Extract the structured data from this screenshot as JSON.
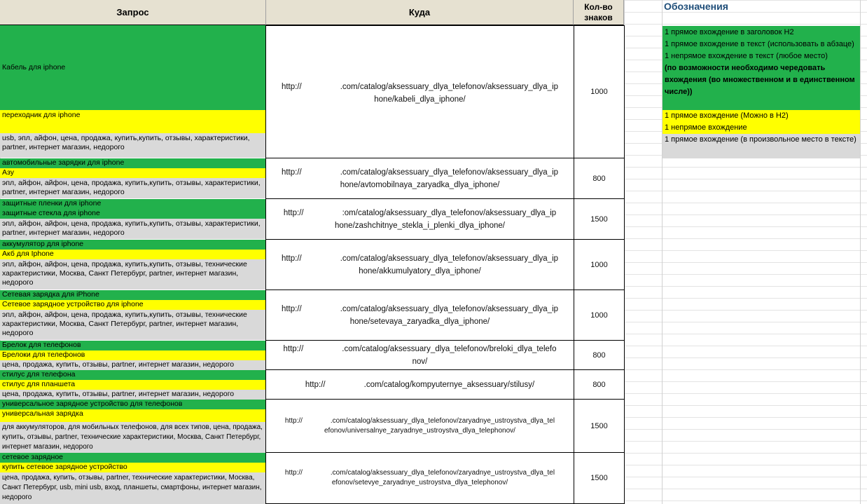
{
  "headers": {
    "query": "Запрос",
    "target": "Куда",
    "chars": "Кол-во знаков",
    "legend": "Обозначения"
  },
  "rows": [
    {
      "green": [
        "Кабель для iphone"
      ],
      "yellow": [
        "переходник для iphone"
      ],
      "gray": "usb, эпл, айфон, цена, продажа, купить,купить, отзывы, характеристики, partner, интернет магазин, недорого",
      "url": "http://[redacted].com/catalog/aksessuary_dlya_telefonov/aksessuary_dlya_iphone/kabeli_dlya_iphone/",
      "chars": "1000"
    },
    {
      "green": [
        "автомобильные зарядки для iphone"
      ],
      "yellow": [
        "Азу"
      ],
      "gray": "эпл, айфон, айфон, цена, продажа, купить,купить, отзывы, характеристики, partner, интернет магазин, недорого",
      "url": "http://[redacted].com/catalog/aksessuary_dlya_telefonov/aksessuary_dlya_iphone/avtomobilnaya_zaryadka_dlya_iphone/",
      "chars": "800"
    },
    {
      "green": [
        "защитные пленки для iphone",
        "защитные стекла для iphone"
      ],
      "yellow": [],
      "gray": "эпл, айфон, айфон, цена, продажа, купить,купить, отзывы, характеристики, partner, интернет магазин, недорого",
      "url": "http://[redacted].com/catalog/aksessuary_dlya_telefonov/aksessuary_dlya_iphone/zashchitnye_stekla_i_plenki_dlya_iphone/",
      "chars": "1500"
    },
    {
      "green": [
        "аккумулятор для iphone"
      ],
      "yellow": [
        "Акб для Iphone"
      ],
      "gray": "эпл, айфон, айфон, цена, продажа, купить,купить, отзывы, технические характеристики, Москва, Санкт Петербург, partner, интернет магазин, недорого",
      "url": "http://[redacted].com/catalog/aksessuary_dlya_telefonov/aksessuary_dlya_iphone/akkumulyatory_dlya_iphone/",
      "chars": "1000"
    },
    {
      "green": [
        "Сетевая зарядка для iPhone"
      ],
      "yellow": [
        "Сетевое зарядное устройство для iphone"
      ],
      "gray": "эпл, айфон, айфон, цена, продажа, купить,купить, отзывы, технические характеристики, Москва, Санкт Петербург, partner, интернет магазин, недорого",
      "url": "http://[redacted].com/catalog/aksessuary_dlya_telefonov/aksessuary_dlya_iphone/setevaya_zaryadka_dlya_iphone/",
      "chars": "1000"
    },
    {
      "green": [
        "Брелок для телефонов"
      ],
      "yellow": [
        "Брелоки для телефонов"
      ],
      "gray": "цена, продажа, купить, отзывы, partner, интернет магазин, недорого",
      "url": "http://[redacted].com/catalog/aksessuary_dlya_telefonov/breloki_dlya_telefonov/",
      "chars": "800"
    },
    {
      "green": [
        "стилус для телефона"
      ],
      "yellow": [
        "стилус для планшета"
      ],
      "gray": "цена, продажа, купить, отзывы, partner, интернет магазин, недорого",
      "url": "http://[redacted].com/catalog/kompyuternye_aksessuary/stilusy/",
      "chars": "800"
    },
    {
      "green": [
        "универсальное зарядное устройство для телефонов"
      ],
      "yellow": [
        "универсальная зарядка"
      ],
      "gray": "для аккумуляторов, для мобильных телефонов, для всех типов, цена, продажа, купить, отзывы, partner, технические характеристики, Москва, Санкт Петербург, интернет магазин, недорого",
      "url": "http://[redacted].com/catalog/aksessuary_dlya_telefonov/zaryadnye_ustroystva_dlya_telefonov/universalnye_zaryadnye_ustroystva_dlya_telephonov/",
      "chars": "1500"
    },
    {
      "green": [
        "сетевое зарядное"
      ],
      "yellow": [
        "купить сетевое зарядное устройство"
      ],
      "gray": "цена, продажа, купить, отзывы, partner, технические характеристики, Москва, Санкт Петербург, usb, mini usb, вход, планшеты, смартфоны, интернет магазин, недорого",
      "url": "http://[redacted].com/catalog/aksessuary_dlya_telefonov/zaryadnye_ustroystva_dlya_telefonov/setevye_zaryadnye_ustroystva_dlya_telephonov/",
      "chars": "1500"
    }
  ],
  "url_display": [
    [
      "http://",
      ".com/catalog/aksessuary_dlya_telefonov/aksessuary_dlya_ip",
      "hone/kabeli_dlya_iphone/"
    ],
    [
      "http://",
      ".com/catalog/aksessuary_dlya_telefonov/aksessuary_dlya_ip",
      "hone/avtomobilnaya_zaryadka_dlya_iphone/"
    ],
    [
      "http://",
      ":om/catalog/aksessuary_dlya_telefonov/aksessuary_dlya_ip",
      "hone/zashchitnye_stekla_i_plenki_dlya_iphone/"
    ],
    [
      "http://",
      ".com/catalog/aksessuary_dlya_telefonov/aksessuary_dlya_ip",
      "hone/akkumulyatory_dlya_iphone/"
    ],
    [
      "http://",
      ".com/catalog/aksessuary_dlya_telefonov/aksessuary_dlya_ip",
      "hone/setevaya_zaryadka_dlya_iphone/"
    ],
    [
      "http://",
      ".com/catalog/aksessuary_dlya_telefonov/breloki_dlya_telefo",
      "nov/"
    ],
    [
      "http://",
      ".com/catalog/kompyuternye_aksessuary/stilusy/",
      ""
    ],
    [
      "http://",
      ".com/catalog/aksessuary_dlya_telefonov/zaryadnye_ustroystva_dlya_tel",
      "efonov/universalnye_zaryadnye_ustroystva_dlya_telephonov/"
    ],
    [
      "http://",
      ".com/catalog/aksessuary_dlya_telefonov/zaryadnye_ustroystva_dlya_tel",
      "efonov/setevye_zaryadnye_ustroystva_dlya_telephonov/"
    ]
  ],
  "legend": {
    "green": [
      "1 прямое вхождение в заголовок H2",
      "1 прямое вхождение в текст (использовать в абзаце)",
      "1 непрямое вхождение в текст (любое место)"
    ],
    "green_bold": "(по возможности необходимо чередовать вхождения (во множественном и в единственном числе))",
    "yellow": [
      "1 прямое вхождение (Можно в H2)",
      "1 непрямое вхождение"
    ],
    "gray": "1 прямое вхождение (в произвольное место в тексте)"
  },
  "colors": {
    "green": "#22b14c",
    "yellow": "#ffff00",
    "gray": "#d9d9d9",
    "header": "#e6e1d1",
    "legend_title": "#1f4e79"
  }
}
